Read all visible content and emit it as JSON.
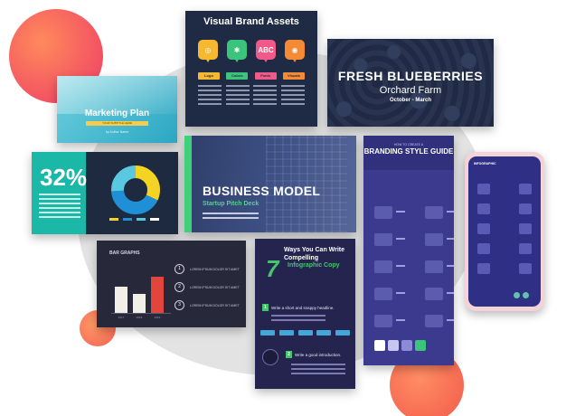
{
  "marketing_plan": {
    "title": "Marketing Plan",
    "subtitle": "YOUR SUBTITLE HERE",
    "author": "by Author Name"
  },
  "brand_assets": {
    "title": "Visual Brand Assets",
    "icons": [
      {
        "name": "logo-icon",
        "glyph": "◎",
        "color": "#f5b82e",
        "tag": "Logo"
      },
      {
        "name": "colors-icon",
        "glyph": "✱",
        "color": "#3cc47c",
        "tag": "Colors"
      },
      {
        "name": "fonts-icon",
        "glyph": "ABC",
        "color": "#f15a88",
        "tag": "Fonts"
      },
      {
        "name": "camera-icon",
        "glyph": "◉",
        "color": "#f58a34",
        "tag": "Visuals"
      }
    ]
  },
  "blueberries": {
    "title": "FRESH BLUEBERRIES",
    "subtitle": "Orchard Farm",
    "season": "October - March"
  },
  "stat_card": {
    "value": "32%",
    "accent_color": "#1cb8a7",
    "donut": [
      {
        "value": 0.32,
        "color": "#f5d323"
      },
      {
        "value": 0.42,
        "color": "#1f8fd6"
      },
      {
        "value": 0.26,
        "color": "#5ac8e0"
      }
    ]
  },
  "business_model": {
    "title": "BUSINESS MODEL",
    "subtitle": "Startup Pitch Deck"
  },
  "style_guide": {
    "kicker": "HOW TO CREATE A",
    "title": "BRANDING STYLE GUIDE",
    "swatches": [
      "#ffffff",
      "#c6c6f0",
      "#8b8bd8",
      "#3cc47c"
    ]
  },
  "bar_chart": {
    "title": "BAR GRAPHS",
    "items": [
      {
        "num": "1",
        "text": "LOREM IPSUM DOLOR SIT AMET"
      },
      {
        "num": "2",
        "text": "LOREM IPSUM DOLOR SIT AMET"
      },
      {
        "num": "3",
        "text": "LOREM IPSUM DOLOR SIT AMET"
      }
    ]
  },
  "chart_data": {
    "type": "bar",
    "categories": [
      "2017",
      "2018",
      "2019"
    ],
    "values": [
      30,
      22,
      42
    ],
    "colors": [
      "#f2efe9",
      "#f2efe9",
      "#e2453c"
    ],
    "title": "BAR GRAPHS",
    "ylim": [
      0,
      50
    ]
  },
  "infographic": {
    "number": "7",
    "title": "Ways You Can Write Compelling",
    "highlight": "Infographic Copy",
    "steps": [
      {
        "num": "1",
        "text": "Write a short and snappy headline."
      },
      {
        "num": "2",
        "text": "Write a good introduction."
      }
    ]
  },
  "phone": {
    "header": "INFOGRAPHIC"
  }
}
